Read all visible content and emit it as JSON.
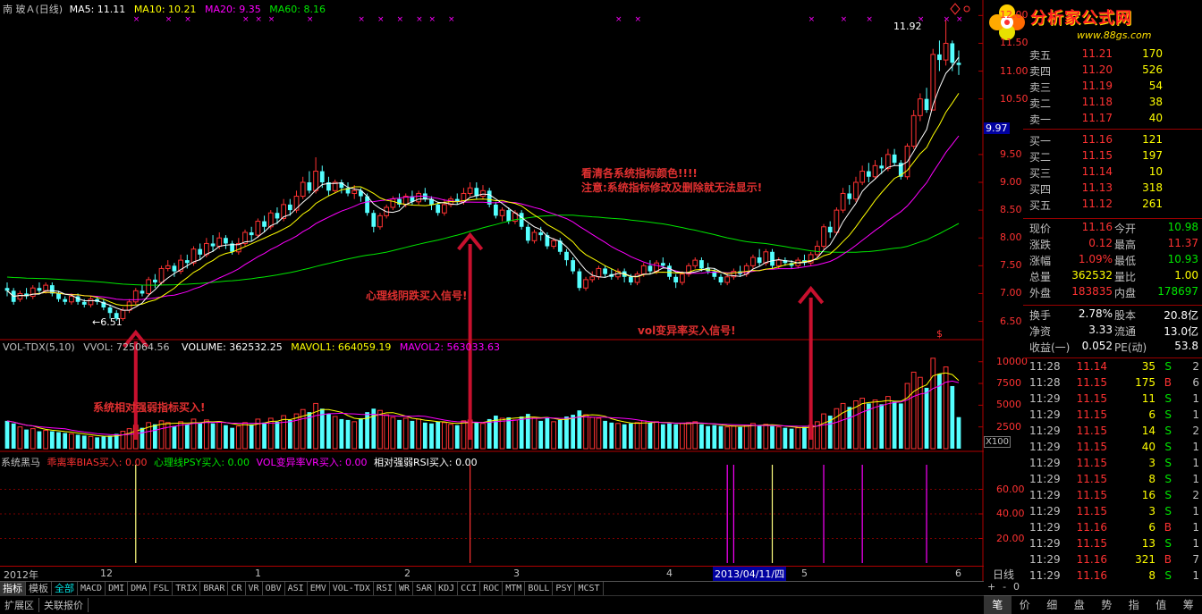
{
  "header": {
    "stock_name": "南 玻Ａ(日线)",
    "ma5_label": "MA5: 11.11",
    "ma10_label": "MA10: 10.21",
    "ma20_label": "MA20: 9.35",
    "ma60_label": "MA60: 8.16"
  },
  "colors": {
    "up": "#ff3232",
    "down": "#54ffff",
    "ma5": "#ffffff",
    "ma10": "#ffff00",
    "ma20": "#ff00ff",
    "ma60": "#00e600",
    "grid": "#7a0000",
    "arrow": "#c8102e",
    "annot_red": "#e03030"
  },
  "annotations": {
    "warning_line1": "看清各系统指标颜色!!!!",
    "warning_line2": "注意:系统指标修改及删除就无法显示!",
    "psy_signal": "心理线阴跌买入信号!",
    "vr_signal": "vol变异率买入信号!",
    "rsi_signal": "系统相对强弱指标买入!",
    "low_label": "←6.51",
    "high_label": "11.92",
    "s_marker": "$"
  },
  "volume_header": {
    "title": "VOL-TDX(5,10)",
    "vvol": "VVOL: 725064.56",
    "volume": "VOLUME: 362532.25",
    "mavol1": "MAVOL1: 664059.19",
    "mavol2": "MAVOL2: 563033.63",
    "unit": "X100"
  },
  "signal_header": {
    "title": "系统黑马",
    "bias": "乖离率BIAS买入: 0.00",
    "psy": "心理线PSY买入: 0.00",
    "vr": "VOL变异率VR买入: 0.00",
    "rsi": "相对强弱RSI买入: 0.00"
  },
  "date_axis": {
    "labels": [
      "2012年",
      "12",
      "1",
      "2",
      "3",
      "4",
      "5",
      "6"
    ],
    "highlight": "2013/04/11/四",
    "period": "日线"
  },
  "tabs": [
    "指标",
    "模板",
    "全部",
    "MACD",
    "DMI",
    "DMA",
    "FSL",
    "TRIX",
    "BRAR",
    "CR",
    "VR",
    "OBV",
    "ASI",
    "EMV",
    "VOL-TDX",
    "RSI",
    "WR",
    "SAR",
    "KDJ",
    "CCI",
    "ROC",
    "MTM",
    "BOLL",
    "PSY",
    "MCST"
  ],
  "bottom_tabs": [
    "扩展区",
    "关联报价"
  ],
  "nav": [
    "+",
    "-",
    "0"
  ],
  "brand": {
    "name": "分析家公式网",
    "url": "www.88gs.com"
  },
  "price_axis": [
    "12.00",
    "11.50",
    "11.00",
    "10.50",
    "9.97",
    "9.50",
    "9.00",
    "8.50",
    "8.00",
    "7.50",
    "7.00",
    "6.50"
  ],
  "vol_axis": [
    "10000",
    "7500",
    "5000",
    "2500"
  ],
  "sig_axis": [
    "60.00",
    "40.00",
    "20.00"
  ],
  "order_book": {
    "sell": [
      {
        "label": "卖五",
        "price": "11.21",
        "vol": "170"
      },
      {
        "label": "卖四",
        "price": "11.20",
        "vol": "526"
      },
      {
        "label": "卖三",
        "price": "11.19",
        "vol": "54"
      },
      {
        "label": "卖二",
        "price": "11.18",
        "vol": "38"
      },
      {
        "label": "卖一",
        "price": "11.17",
        "vol": "40"
      }
    ],
    "buy": [
      {
        "label": "买一",
        "price": "11.16",
        "vol": "121"
      },
      {
        "label": "买二",
        "price": "11.15",
        "vol": "197"
      },
      {
        "label": "买三",
        "price": "11.14",
        "vol": "10"
      },
      {
        "label": "买四",
        "price": "11.13",
        "vol": "318"
      },
      {
        "label": "买五",
        "price": "11.12",
        "vol": "261"
      }
    ]
  },
  "quote": [
    {
      "l1": "现价",
      "v1": "11.16",
      "c1": "#ff3232",
      "l2": "今开",
      "v2": "10.98",
      "c2": "#00e600"
    },
    {
      "l1": "涨跌",
      "v1": "0.12",
      "c1": "#ff3232",
      "l2": "最高",
      "v2": "11.37",
      "c2": "#ff3232"
    },
    {
      "l1": "涨幅",
      "v1": "1.09%",
      "c1": "#ff3232",
      "l2": "最低",
      "v2": "10.93",
      "c2": "#00e600"
    },
    {
      "l1": "总量",
      "v1": "362532",
      "c1": "#ffff00",
      "l2": "量比",
      "v2": "1.00",
      "c2": "#ffff00"
    },
    {
      "l1": "外盘",
      "v1": "183835",
      "c1": "#ff3232",
      "l2": "内盘",
      "v2": "178697",
      "c2": "#00e600"
    }
  ],
  "stats": [
    {
      "l1": "换手",
      "v1": "2.78%",
      "l2": "股本",
      "v2": "20.8亿"
    },
    {
      "l1": "净资",
      "v1": "3.33",
      "l2": "流通",
      "v2": "13.0亿"
    },
    {
      "l1": "收益(一)",
      "v1": "0.052",
      "l2": "PE(动)",
      "v2": "53.8"
    }
  ],
  "ticks": [
    {
      "t": "11:28",
      "p": "11.14",
      "v": "35",
      "s": "S",
      "n": "2"
    },
    {
      "t": "11:28",
      "p": "11.15",
      "v": "175",
      "s": "B",
      "n": "6"
    },
    {
      "t": "11:29",
      "p": "11.15",
      "v": "11",
      "s": "S",
      "n": "1"
    },
    {
      "t": "11:29",
      "p": "11.15",
      "v": "6",
      "s": "S",
      "n": "1"
    },
    {
      "t": "11:29",
      "p": "11.15",
      "v": "14",
      "s": "S",
      "n": "2"
    },
    {
      "t": "11:29",
      "p": "11.15",
      "v": "40",
      "s": "S",
      "n": "1"
    },
    {
      "t": "11:29",
      "p": "11.15",
      "v": "3",
      "s": "S",
      "n": "1"
    },
    {
      "t": "11:29",
      "p": "11.15",
      "v": "8",
      "s": "S",
      "n": "1"
    },
    {
      "t": "11:29",
      "p": "11.15",
      "v": "16",
      "s": "S",
      "n": "2"
    },
    {
      "t": "11:29",
      "p": "11.15",
      "v": "3",
      "s": "S",
      "n": "1"
    },
    {
      "t": "11:29",
      "p": "11.16",
      "v": "6",
      "s": "B",
      "n": "1"
    },
    {
      "t": "11:29",
      "p": "11.15",
      "v": "13",
      "s": "S",
      "n": "1"
    },
    {
      "t": "11:29",
      "p": "11.16",
      "v": "321",
      "s": "B",
      "n": "7"
    },
    {
      "t": "11:29",
      "p": "11.16",
      "v": "8",
      "s": "S",
      "n": "1"
    }
  ],
  "right_tabs": [
    "笔",
    "价",
    "细",
    "盘",
    "势",
    "指",
    "值",
    "筹"
  ],
  "chart_data": {
    "type": "candlestick",
    "price_range": [
      6.3,
      12.15
    ],
    "volume_range": [
      0,
      11000
    ],
    "signal_range": [
      0,
      80
    ],
    "candles": [
      [
        7.1,
        7.05,
        7.2,
        6.95,
        3200
      ],
      [
        7.05,
        6.85,
        7.1,
        6.8,
        2900
      ],
      [
        6.9,
        7.0,
        7.05,
        6.85,
        2500
      ],
      [
        7.0,
        6.95,
        7.1,
        6.9,
        2200
      ],
      [
        6.95,
        7.1,
        7.15,
        6.9,
        2300
      ],
      [
        7.1,
        7.05,
        7.2,
        7.0,
        2000
      ],
      [
        7.05,
        7.15,
        7.2,
        7.0,
        2100
      ],
      [
        7.15,
        7.0,
        7.2,
        6.95,
        2000
      ],
      [
        7.0,
        6.9,
        7.05,
        6.85,
        1900
      ],
      [
        6.9,
        6.85,
        6.95,
        6.8,
        1800
      ],
      [
        6.85,
        6.95,
        7.0,
        6.8,
        1700
      ],
      [
        6.95,
        6.85,
        7.0,
        6.8,
        1600
      ],
      [
        6.85,
        6.8,
        6.9,
        6.75,
        1500
      ],
      [
        6.8,
        6.9,
        6.95,
        6.75,
        1400
      ],
      [
        6.9,
        6.85,
        6.95,
        6.8,
        1300
      ],
      [
        6.85,
        6.75,
        6.9,
        6.7,
        1400
      ],
      [
        6.75,
        6.65,
        6.8,
        6.55,
        1500
      ],
      [
        6.65,
        6.55,
        6.7,
        6.51,
        1700
      ],
      [
        6.55,
        6.7,
        6.75,
        6.51,
        2000
      ],
      [
        6.7,
        6.85,
        6.9,
        6.65,
        2300
      ],
      [
        6.85,
        7.05,
        7.1,
        6.8,
        2700
      ],
      [
        7.05,
        7.0,
        7.15,
        6.95,
        2400
      ],
      [
        7.0,
        7.25,
        7.3,
        6.95,
        3000
      ],
      [
        7.25,
        7.2,
        7.35,
        7.1,
        2800
      ],
      [
        7.2,
        7.45,
        7.5,
        7.15,
        3200
      ],
      [
        7.45,
        7.5,
        7.6,
        7.4,
        3000
      ],
      [
        7.5,
        7.4,
        7.55,
        7.3,
        2600
      ],
      [
        7.4,
        7.6,
        7.7,
        7.35,
        3100
      ],
      [
        7.6,
        7.55,
        7.7,
        7.45,
        2800
      ],
      [
        7.55,
        7.8,
        7.85,
        7.5,
        3400
      ],
      [
        7.8,
        7.7,
        7.9,
        7.6,
        3000
      ],
      [
        7.7,
        7.9,
        8.0,
        7.65,
        3300
      ],
      [
        7.9,
        7.85,
        8.05,
        7.75,
        2900
      ],
      [
        7.85,
        8.0,
        8.1,
        7.8,
        3100
      ],
      [
        8.0,
        7.9,
        8.05,
        7.8,
        2700
      ],
      [
        7.9,
        7.75,
        7.95,
        7.7,
        2400
      ],
      [
        7.75,
        7.9,
        8.0,
        7.7,
        2600
      ],
      [
        7.9,
        8.1,
        8.15,
        7.85,
        3000
      ],
      [
        8.1,
        8.05,
        8.2,
        7.95,
        2800
      ],
      [
        8.05,
        8.3,
        8.35,
        8.0,
        3400
      ],
      [
        8.3,
        8.2,
        8.4,
        8.1,
        3000
      ],
      [
        8.2,
        8.45,
        8.5,
        8.15,
        3500
      ],
      [
        8.45,
        8.35,
        8.55,
        8.25,
        3100
      ],
      [
        8.35,
        8.6,
        8.7,
        8.3,
        3800
      ],
      [
        8.6,
        8.5,
        8.7,
        8.4,
        3300
      ],
      [
        8.5,
        8.75,
        8.85,
        8.45,
        4000
      ],
      [
        8.75,
        9.0,
        9.1,
        8.7,
        4500
      ],
      [
        9.0,
        8.85,
        9.2,
        8.8,
        4200
      ],
      [
        8.85,
        9.2,
        9.45,
        8.8,
        5200
      ],
      [
        9.2,
        9.0,
        9.3,
        8.9,
        4600
      ],
      [
        9.0,
        8.85,
        9.1,
        8.75,
        4000
      ],
      [
        8.85,
        9.0,
        9.05,
        8.8,
        3700
      ],
      [
        9.0,
        8.9,
        9.05,
        8.8,
        3400
      ],
      [
        8.9,
        8.8,
        9.0,
        8.75,
        3300
      ],
      [
        8.8,
        8.85,
        8.95,
        8.7,
        3100
      ],
      [
        8.85,
        8.75,
        8.9,
        8.65,
        3500
      ],
      [
        8.75,
        8.45,
        8.8,
        8.4,
        4200
      ],
      [
        8.45,
        8.2,
        8.5,
        8.1,
        4600
      ],
      [
        8.2,
        8.4,
        8.45,
        8.15,
        4400
      ],
      [
        8.4,
        8.55,
        8.6,
        8.35,
        3900
      ],
      [
        8.55,
        8.7,
        8.75,
        8.5,
        3600
      ],
      [
        8.7,
        8.6,
        8.8,
        8.55,
        3300
      ],
      [
        8.6,
        8.75,
        8.8,
        8.55,
        3500
      ],
      [
        8.75,
        8.65,
        8.85,
        8.6,
        3200
      ],
      [
        8.65,
        8.8,
        8.85,
        8.6,
        3400
      ],
      [
        8.8,
        8.7,
        8.9,
        8.65,
        3000
      ],
      [
        8.7,
        8.6,
        8.75,
        8.5,
        2900
      ],
      [
        8.6,
        8.45,
        8.65,
        8.4,
        3100
      ],
      [
        8.45,
        8.6,
        8.7,
        8.4,
        3000
      ],
      [
        8.6,
        8.7,
        8.75,
        8.55,
        2800
      ],
      [
        8.7,
        8.65,
        8.8,
        8.6,
        2700
      ],
      [
        8.65,
        8.8,
        8.9,
        8.6,
        3200
      ],
      [
        8.8,
        8.9,
        9.0,
        8.75,
        3300
      ],
      [
        8.9,
        8.75,
        9.0,
        8.7,
        3000
      ],
      [
        8.75,
        8.85,
        8.95,
        8.7,
        2900
      ],
      [
        8.85,
        8.6,
        8.9,
        8.55,
        3400
      ],
      [
        8.6,
        8.4,
        8.65,
        8.35,
        3800
      ],
      [
        8.4,
        8.5,
        8.55,
        8.3,
        3500
      ],
      [
        8.5,
        8.3,
        8.55,
        8.25,
        3600
      ],
      [
        8.3,
        8.45,
        8.5,
        8.25,
        3300
      ],
      [
        8.45,
        8.2,
        8.5,
        8.15,
        3700
      ],
      [
        8.2,
        7.95,
        8.25,
        7.9,
        4000
      ],
      [
        7.95,
        8.1,
        8.15,
        7.9,
        3600
      ],
      [
        8.1,
        8.05,
        8.2,
        7.95,
        3200
      ],
      [
        8.05,
        7.85,
        8.1,
        7.8,
        3500
      ],
      [
        7.85,
        7.95,
        8.0,
        7.8,
        3100
      ],
      [
        7.95,
        7.75,
        8.0,
        7.7,
        3300
      ],
      [
        7.75,
        7.6,
        7.8,
        7.5,
        3700
      ],
      [
        7.6,
        7.4,
        7.65,
        7.35,
        3900
      ],
      [
        7.4,
        7.1,
        7.45,
        7.05,
        4400
      ],
      [
        7.1,
        7.25,
        7.3,
        7.05,
        3900
      ],
      [
        7.25,
        7.3,
        7.4,
        7.2,
        3600
      ],
      [
        7.3,
        7.45,
        7.5,
        7.25,
        3500
      ],
      [
        7.45,
        7.35,
        7.5,
        7.3,
        3200
      ],
      [
        7.35,
        7.3,
        7.45,
        7.25,
        3000
      ],
      [
        7.3,
        7.4,
        7.45,
        7.25,
        2900
      ],
      [
        7.4,
        7.3,
        7.45,
        7.2,
        2800
      ],
      [
        7.3,
        7.2,
        7.35,
        7.15,
        2900
      ],
      [
        7.2,
        7.35,
        7.4,
        7.15,
        3000
      ],
      [
        7.35,
        7.5,
        7.55,
        7.3,
        3200
      ],
      [
        7.5,
        7.4,
        7.6,
        7.35,
        3000
      ],
      [
        7.4,
        7.55,
        7.6,
        7.35,
        3100
      ],
      [
        7.55,
        7.5,
        7.65,
        7.45,
        2800
      ],
      [
        7.5,
        7.3,
        7.55,
        7.25,
        2900
      ],
      [
        7.3,
        7.2,
        7.35,
        7.1,
        2800
      ],
      [
        7.2,
        7.35,
        7.4,
        7.15,
        2900
      ],
      [
        7.35,
        7.5,
        7.55,
        7.3,
        3000
      ],
      [
        7.5,
        7.6,
        7.65,
        7.45,
        3100
      ],
      [
        7.6,
        7.45,
        7.65,
        7.4,
        2800
      ],
      [
        7.45,
        7.4,
        7.55,
        7.35,
        2600
      ],
      [
        7.4,
        7.3,
        7.45,
        7.25,
        2700
      ],
      [
        7.3,
        7.2,
        7.35,
        7.15,
        2600
      ],
      [
        7.2,
        7.3,
        7.35,
        7.15,
        2500
      ],
      [
        7.3,
        7.4,
        7.45,
        7.25,
        2600
      ],
      [
        7.4,
        7.35,
        7.5,
        7.3,
        2500
      ],
      [
        7.35,
        7.5,
        7.55,
        7.3,
        2700
      ],
      [
        7.5,
        7.65,
        7.7,
        7.45,
        2900
      ],
      [
        7.65,
        7.55,
        7.8,
        7.5,
        2700
      ],
      [
        7.55,
        7.75,
        7.8,
        7.5,
        2800
      ],
      [
        7.75,
        7.5,
        7.8,
        7.45,
        2600
      ],
      [
        7.5,
        7.6,
        7.65,
        7.45,
        2500
      ],
      [
        7.6,
        7.55,
        7.65,
        7.5,
        2400
      ],
      [
        7.55,
        7.5,
        7.6,
        7.45,
        2300
      ],
      [
        7.5,
        7.6,
        7.65,
        7.45,
        2400
      ],
      [
        7.6,
        7.55,
        7.7,
        7.5,
        2500
      ],
      [
        7.55,
        7.7,
        7.75,
        7.5,
        2700
      ],
      [
        7.7,
        7.85,
        7.95,
        7.65,
        3100
      ],
      [
        7.85,
        8.2,
        8.25,
        7.8,
        4000
      ],
      [
        8.2,
        8.1,
        8.3,
        8.0,
        3800
      ],
      [
        8.1,
        8.5,
        8.55,
        8.05,
        4600
      ],
      [
        8.5,
        8.8,
        8.9,
        8.45,
        5200
      ],
      [
        8.8,
        8.7,
        8.95,
        8.6,
        4800
      ],
      [
        8.7,
        9.0,
        9.1,
        8.65,
        5500
      ],
      [
        9.0,
        9.2,
        9.3,
        8.95,
        5800
      ],
      [
        9.2,
        9.1,
        9.35,
        9.0,
        5200
      ],
      [
        9.1,
        9.3,
        9.4,
        9.05,
        5600
      ],
      [
        9.3,
        9.25,
        9.45,
        9.15,
        5100
      ],
      [
        9.25,
        9.5,
        9.6,
        9.2,
        6000
      ],
      [
        9.5,
        9.35,
        9.6,
        9.3,
        5400
      ],
      [
        9.35,
        9.1,
        9.4,
        9.05,
        5200
      ],
      [
        9.1,
        9.65,
        9.7,
        9.05,
        7500
      ],
      [
        9.65,
        10.2,
        10.3,
        9.6,
        8800
      ],
      [
        10.2,
        10.5,
        10.6,
        10.1,
        8200
      ],
      [
        10.5,
        10.3,
        10.7,
        10.25,
        7000
      ],
      [
        10.3,
        11.3,
        11.4,
        10.3,
        10400
      ],
      [
        11.3,
        11.2,
        11.55,
        11.0,
        8600
      ],
      [
        11.2,
        11.5,
        11.92,
        11.1,
        9400
      ],
      [
        11.5,
        11.15,
        11.55,
        11.0,
        7200
      ],
      [
        11.15,
        11.11,
        11.37,
        10.93,
        3625
      ]
    ],
    "signals": [
      {
        "index": 20,
        "value": 80,
        "color": "#ffff80"
      },
      {
        "index": 72,
        "value": 80,
        "color": "#ff3232"
      },
      {
        "index": 112,
        "value": 80,
        "color": "#ff00ff"
      },
      {
        "index": 113,
        "value": 80,
        "color": "#ff00ff"
      },
      {
        "index": 119,
        "value": 80,
        "color": "#ffff80"
      },
      {
        "index": 127,
        "value": 80,
        "color": "#ff00ff"
      },
      {
        "index": 133,
        "value": 80,
        "color": "#ff00ff"
      },
      {
        "index": 143,
        "value": 80,
        "color": "#ff00ff"
      }
    ]
  }
}
